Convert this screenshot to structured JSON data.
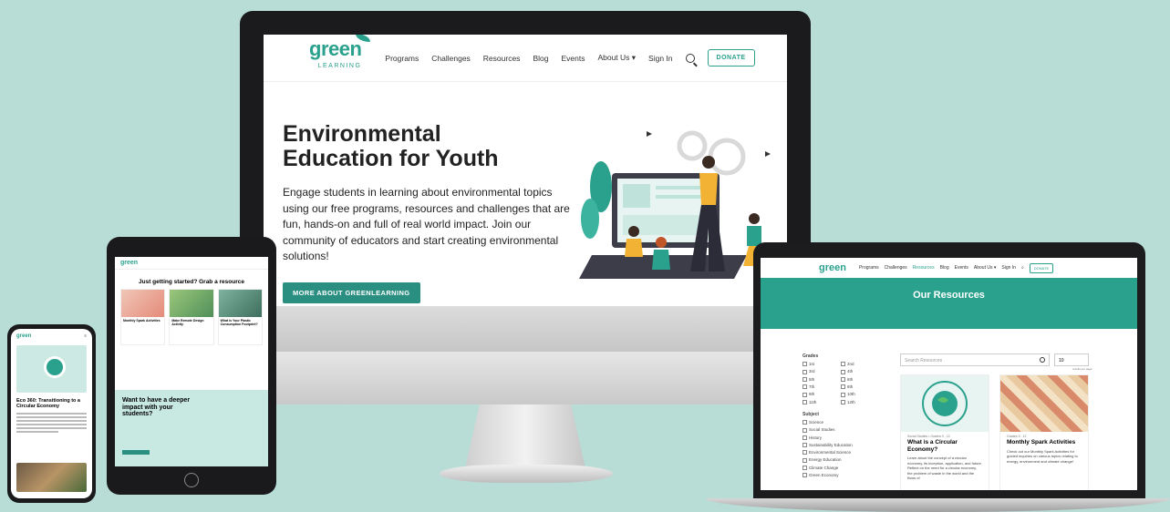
{
  "desktop": {
    "nav": {
      "logo_text": "green",
      "logo_sub": "LEARNING",
      "links": [
        "Programs",
        "Challenges",
        "Resources",
        "Blog",
        "Events",
        "About Us ▾",
        "Sign In"
      ],
      "donate": "DONATE"
    },
    "hero": {
      "title": "Environmental Education for Youth",
      "body": "Engage students in learning about environmental topics using our free programs, resources and challenges that are fun, hands-on and full of real world impact. Join our community of educators and start creating environmental solutions!",
      "cta": "MORE ABOUT GREENLEARNING"
    }
  },
  "tablet": {
    "logo_text": "green",
    "heading": "Just getting started? Grab a resource",
    "cards": [
      "Monthly Spark Activities",
      "Make Remote Design Activity",
      "What is Your Plastic Consumption Footprint?"
    ],
    "band_title": "Want to have a deeper impact with your students?"
  },
  "phone": {
    "logo_text": "green",
    "title": "Eco 360: Transitioning to a Circular Economy"
  },
  "laptop": {
    "nav": {
      "logo_text": "green",
      "links": [
        "Programs",
        "Challenges",
        "Resources",
        "Blog",
        "Events",
        "About Us ▾",
        "Sign In"
      ],
      "donate": "DONATE"
    },
    "banner": "Our Resources",
    "sidebar": {
      "grades_heading": "Grades",
      "grades": [
        "1st",
        "2nd",
        "3rd",
        "4th",
        "5th",
        "6th",
        "7th",
        "8th",
        "9th",
        "10th",
        "11th",
        "12th"
      ],
      "subject_heading": "Subject",
      "subjects": [
        "Science",
        "Social Studies",
        "History",
        "Sustainability Education",
        "Environmental Science",
        "Energy Education",
        "Climate Change",
        "Green Economy"
      ]
    },
    "search_placeholder": "Search Resources",
    "per_page_value": "10",
    "per_page_label": "results per page",
    "cards": [
      {
        "meta": "Social Studies • Grades 9 - 12",
        "title": "What is a Circular Economy?",
        "desc": "Learn about the concept of a circular economy, its inception, application, and future. Reflect on the need for a circular economy, the problem of waste in the world and the flows of"
      },
      {
        "meta": "Grades 3 - 12",
        "title": "Monthly Spark Activities",
        "desc": "Check out our Monthly Spark Activities for guided inquiries on various topics relating to energy, environment and climate change!"
      }
    ]
  }
}
